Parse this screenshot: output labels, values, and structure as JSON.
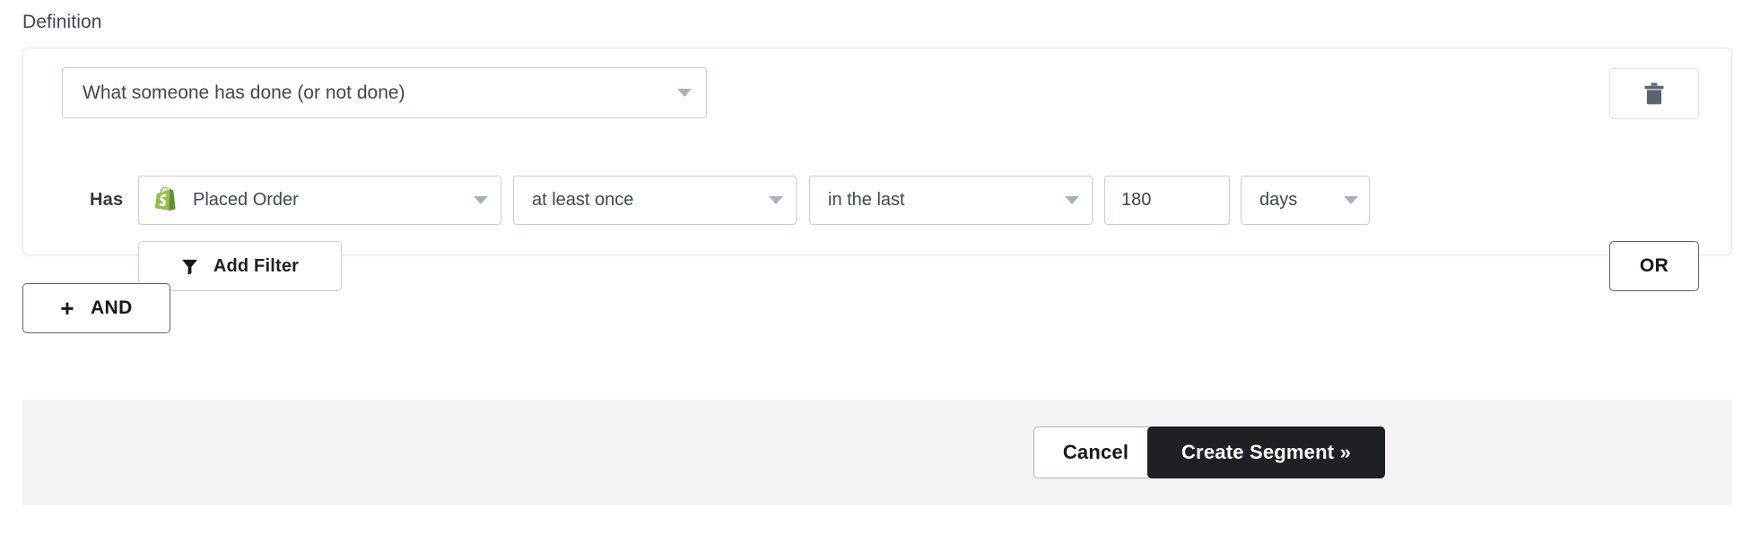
{
  "section": {
    "label": "Definition"
  },
  "condition": {
    "type_select": {
      "value": "What someone has done (or not done)",
      "caret_icon": "chevron-down-icon"
    },
    "delete_button": {
      "icon": "trash-icon"
    },
    "filter_row": {
      "prefix_label": "Has",
      "metric_select": {
        "value": "Placed Order",
        "icon": "shopify-icon",
        "icon_color": "#95bf47",
        "caret_icon": "chevron-down-icon"
      },
      "operator_select": {
        "value": "at least once",
        "caret_icon": "chevron-down-icon"
      },
      "timeframe_select": {
        "value": "in the last",
        "caret_icon": "chevron-down-icon"
      },
      "value_input": {
        "value": "180",
        "placeholder": "0"
      },
      "unit_select": {
        "value": "days",
        "caret_icon": "chevron-down-icon"
      }
    },
    "add_filter_button": {
      "label": "Add Filter",
      "icon": "filter-funnel-icon"
    },
    "or_button": {
      "label": "OR"
    }
  },
  "and_button": {
    "plus": "+",
    "label": "AND"
  },
  "footer": {
    "cancel_button": "Cancel",
    "create_button": "Create Segment »"
  },
  "colors": {
    "panel_border": "#e6e8eb",
    "control_border": "#c8cdd6",
    "text": "#3f4653",
    "footer_background": "#f2f3f5",
    "primary_button": "#1d2024",
    "shopify_green": "#95bf47",
    "caret": "#a9b0bd"
  }
}
